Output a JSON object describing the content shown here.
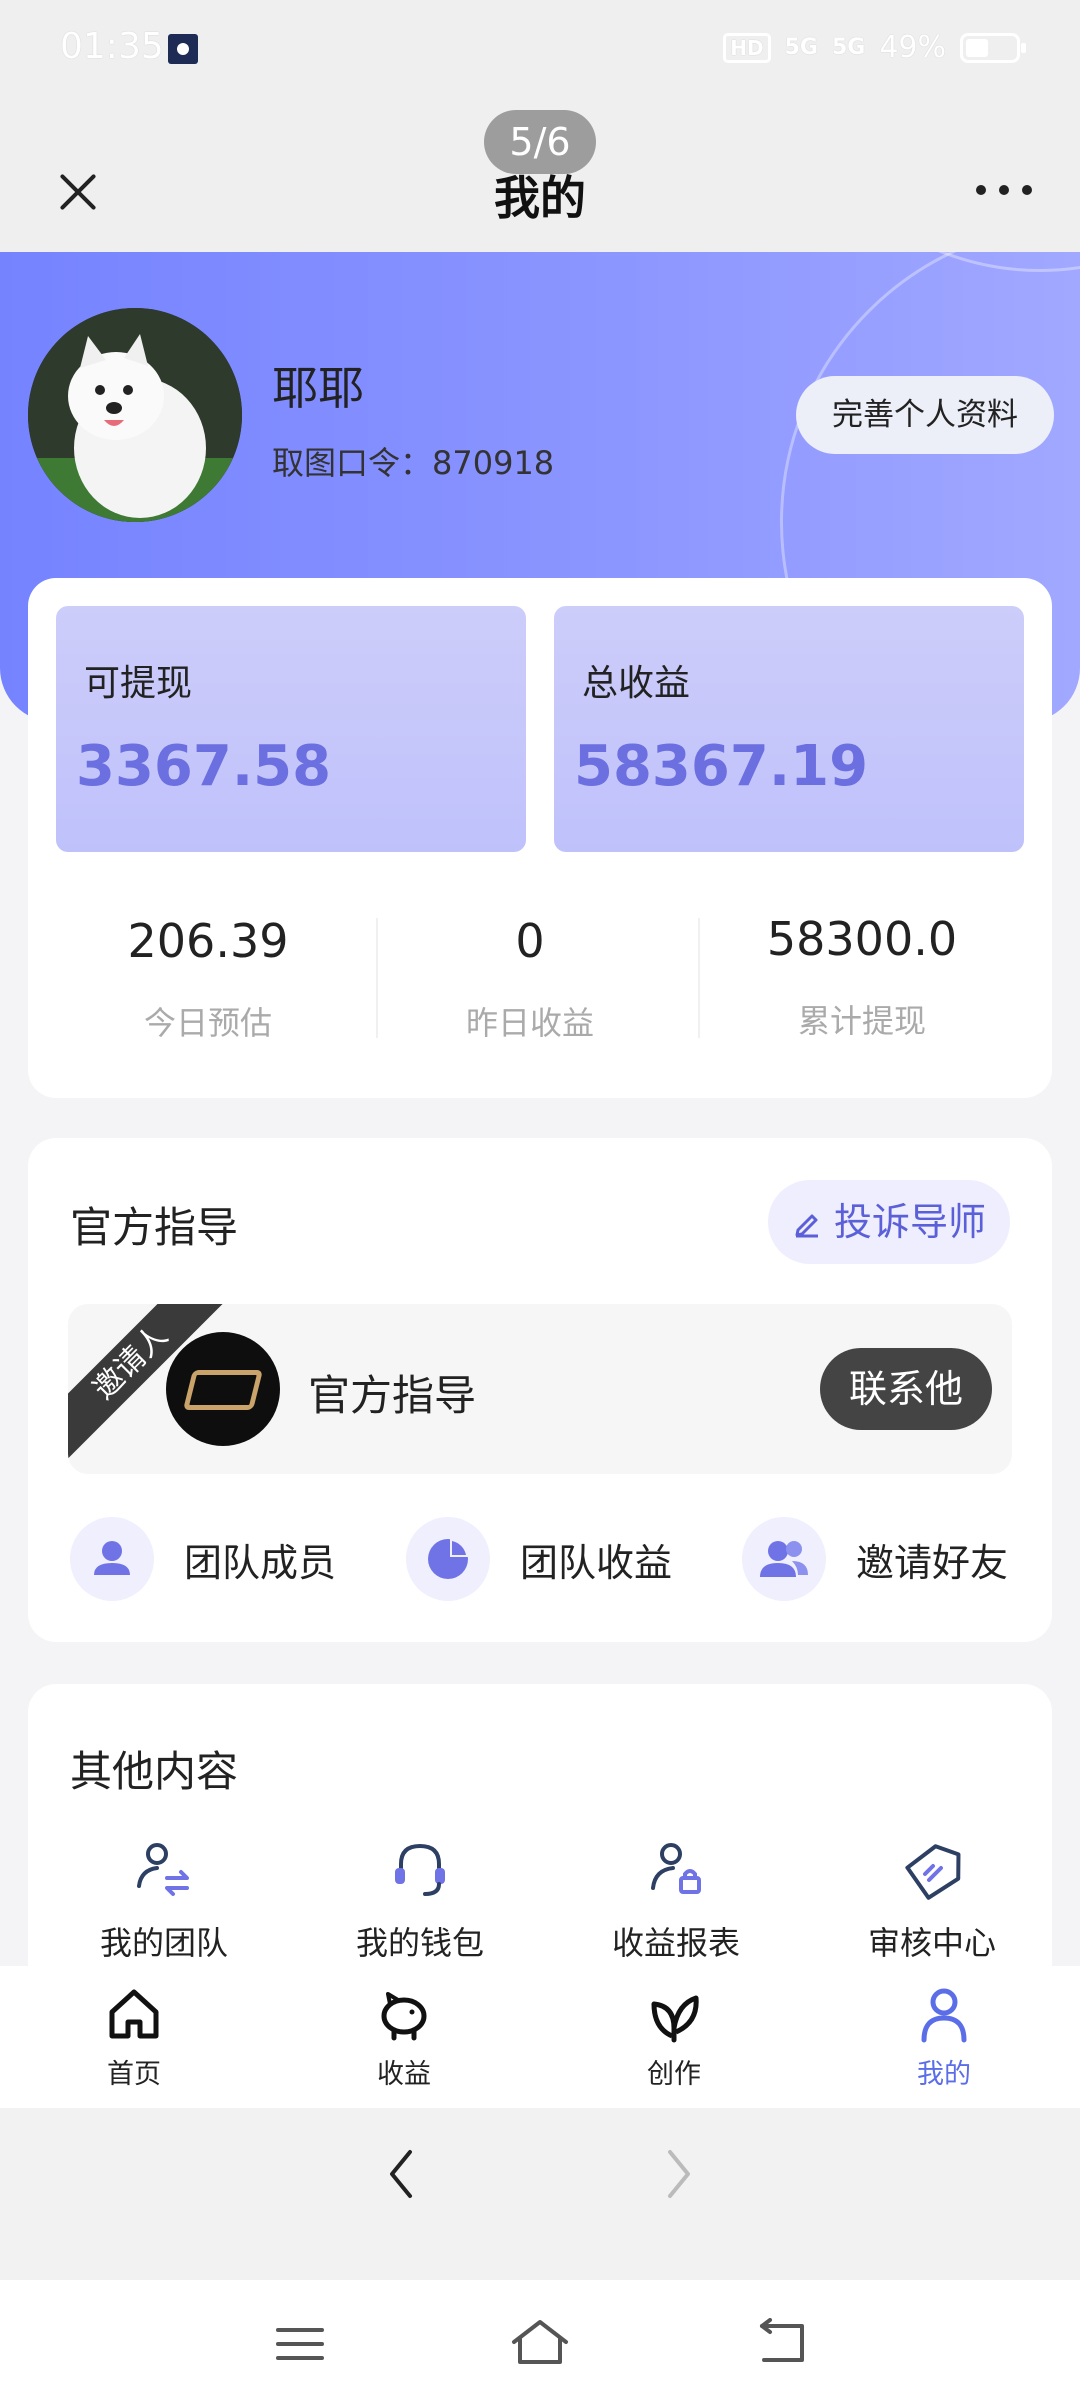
{
  "status_bar": {
    "time": "01:35",
    "hd": "HD",
    "sig1": "5G",
    "sig2": "5G",
    "battery": "49%"
  },
  "title_bar": {
    "title": "我的",
    "page_indicator": "5/6"
  },
  "profile": {
    "name": "耶耶",
    "code_label": "取图口令：870918",
    "edit_button": "完善个人资料"
  },
  "earnings": {
    "withdrawable_label": "可提现",
    "withdrawable_value": "3367.58",
    "total_label": "总收益",
    "total_value": "58367.19",
    "stats": [
      {
        "value": "206.39",
        "caption": "今日预估"
      },
      {
        "value": "0",
        "caption": "昨日收益"
      },
      {
        "value": "58300.0",
        "caption": "累计提现"
      }
    ]
  },
  "guidance": {
    "title": "官方指导",
    "complain_button": "投诉导师",
    "inviter_tag": "邀请人",
    "inviter_name": "官方指导",
    "contact_button": "联系他",
    "quick_links": [
      {
        "label": "团队成员",
        "icon": "person-icon"
      },
      {
        "label": "团队收益",
        "icon": "pie-chart-icon"
      },
      {
        "label": "邀请好友",
        "icon": "group-icon"
      }
    ]
  },
  "other": {
    "title": "其他内容",
    "items": [
      {
        "label": "我的团队",
        "icon": "team-transfer-icon"
      },
      {
        "label": "我的钱包",
        "icon": "headset-icon"
      },
      {
        "label": "收益报表",
        "icon": "user-lock-icon"
      },
      {
        "label": "审核中心",
        "icon": "tag-icon"
      }
    ]
  },
  "bottom_nav": {
    "items": [
      {
        "label": "首页",
        "icon": "home-icon"
      },
      {
        "label": "收益",
        "icon": "piggy-bank-icon"
      },
      {
        "label": "创作",
        "icon": "leaf-icon"
      },
      {
        "label": "我的",
        "icon": "profile-icon"
      }
    ],
    "active_index": 3,
    "active_color": "#5b6ee8"
  },
  "colors": {
    "header_gradient_start": "#7583ff",
    "header_gradient_end": "#a1a8ff",
    "accent": "#6b6fe0",
    "quick_icon": "#6f73e6"
  }
}
